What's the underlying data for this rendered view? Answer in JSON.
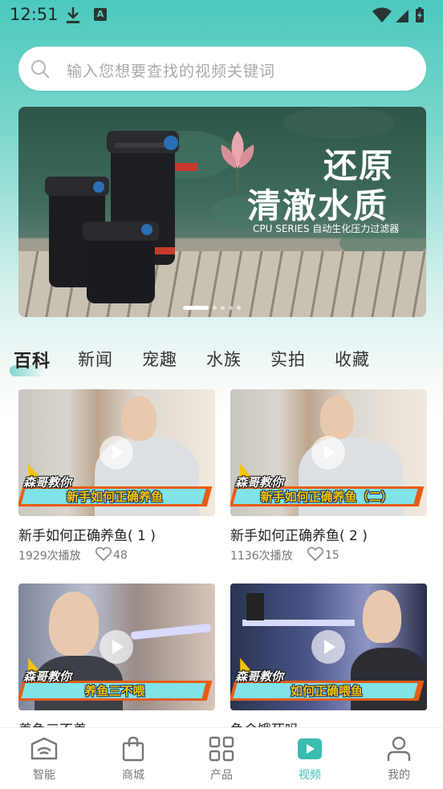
{
  "status_bar": {
    "time": "12:51",
    "a_label": "A"
  },
  "search": {
    "placeholder": "输入您想要查找的视频关键词"
  },
  "banner": {
    "title_line1": "还原",
    "title_line2": "清澈水质",
    "subtitle": "CPU SERIES 自动生化压力过滤器"
  },
  "tabs": [
    {
      "label": "百科",
      "active": true
    },
    {
      "label": "新闻",
      "active": false
    },
    {
      "label": "宠趣",
      "active": false
    },
    {
      "label": "水族",
      "active": false
    },
    {
      "label": "实拍",
      "active": false
    },
    {
      "label": "收藏",
      "active": false
    }
  ],
  "videos": [
    {
      "brand": "森哥教你",
      "caption": "新手如何正确养鱼",
      "title": "新手如何正确养鱼( 1 )",
      "plays": "1929次播放",
      "likes": "48"
    },
    {
      "brand": "森哥教你",
      "caption": "新手如何正确养鱼（二）",
      "title": "新手如何正确养鱼( 2 )",
      "plays": "1136次播放",
      "likes": "15"
    },
    {
      "brand": "森哥教你",
      "caption": "养鱼三不喂",
      "title": "养鱼三不养",
      "plays": "",
      "likes": ""
    },
    {
      "brand": "森哥教你",
      "caption": "如何正确喂鱼",
      "title": "鱼会饿死吗",
      "plays": "",
      "likes": ""
    }
  ],
  "bottom_nav": [
    {
      "label": "智能",
      "icon": "router-icon",
      "active": false
    },
    {
      "label": "商城",
      "icon": "shopping-bag-icon",
      "active": false
    },
    {
      "label": "产品",
      "icon": "grid-icon",
      "active": false
    },
    {
      "label": "视频",
      "icon": "play-icon",
      "active": true
    },
    {
      "label": "我的",
      "icon": "user-icon",
      "active": false
    }
  ],
  "colors": {
    "accent": "#3bbcb0",
    "header_teal": "#4cc9bd",
    "ribbon_orange": "#e85c12"
  }
}
